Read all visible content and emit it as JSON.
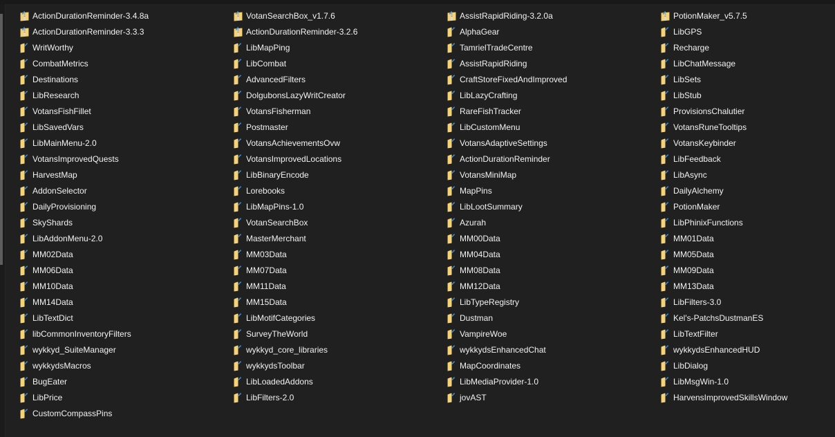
{
  "window": {
    "view_mode": "list",
    "colors": {
      "background": "#202020",
      "text": "#f2f2f2",
      "folder_yellow": "#f4d27a",
      "sync_arrow_blue": "#3a8fd8"
    }
  },
  "scrollbar": {
    "orientation": "vertical",
    "position_fraction": 0.0,
    "visible_fraction": 0.58
  },
  "columns": [
    {
      "items": [
        {
          "name": "ActionDurationReminder-3.4.8a",
          "icon": "zip-folder-icon"
        },
        {
          "name": "ActionDurationReminder-3.3.3",
          "icon": "zip-folder-icon"
        },
        {
          "name": "WritWorthy",
          "icon": "folder-icon"
        },
        {
          "name": "CombatMetrics",
          "icon": "folder-icon"
        },
        {
          "name": "Destinations",
          "icon": "folder-icon"
        },
        {
          "name": "LibResearch",
          "icon": "folder-icon"
        },
        {
          "name": "VotansFishFillet",
          "icon": "folder-icon"
        },
        {
          "name": "LibSavedVars",
          "icon": "folder-icon"
        },
        {
          "name": "LibMainMenu-2.0",
          "icon": "folder-icon"
        },
        {
          "name": "VotansImprovedQuests",
          "icon": "folder-icon"
        },
        {
          "name": "HarvestMap",
          "icon": "folder-icon"
        },
        {
          "name": "AddonSelector",
          "icon": "folder-icon"
        },
        {
          "name": "DailyProvisioning",
          "icon": "folder-icon"
        },
        {
          "name": "SkyShards",
          "icon": "folder-icon"
        },
        {
          "name": "LibAddonMenu-2.0",
          "icon": "folder-icon"
        },
        {
          "name": "MM02Data",
          "icon": "folder-icon"
        },
        {
          "name": "MM06Data",
          "icon": "folder-icon"
        },
        {
          "name": "MM10Data",
          "icon": "folder-icon"
        },
        {
          "name": "MM14Data",
          "icon": "folder-icon"
        },
        {
          "name": "LibTextDict",
          "icon": "folder-icon"
        },
        {
          "name": "libCommonInventoryFilters",
          "icon": "folder-icon"
        },
        {
          "name": "wykkyd_SuiteManager",
          "icon": "folder-icon"
        },
        {
          "name": "wykkydsMacros",
          "icon": "folder-icon"
        },
        {
          "name": "BugEater",
          "icon": "folder-icon"
        },
        {
          "name": "LibPrice",
          "icon": "folder-icon"
        },
        {
          "name": "CustomCompassPins",
          "icon": "folder-icon"
        }
      ]
    },
    {
      "items": [
        {
          "name": "VotanSearchBox_v1.7.6",
          "icon": "zip-folder-icon"
        },
        {
          "name": "ActionDurationReminder-3.2.6",
          "icon": "zip-folder-icon"
        },
        {
          "name": "LibMapPing",
          "icon": "folder-icon"
        },
        {
          "name": "LibCombat",
          "icon": "folder-icon"
        },
        {
          "name": "AdvancedFilters",
          "icon": "folder-icon"
        },
        {
          "name": "DolgubonsLazyWritCreator",
          "icon": "folder-icon"
        },
        {
          "name": "VotansFisherman",
          "icon": "folder-icon"
        },
        {
          "name": "Postmaster",
          "icon": "folder-icon"
        },
        {
          "name": "VotansAchievementsOvw",
          "icon": "folder-icon"
        },
        {
          "name": "VotansImprovedLocations",
          "icon": "folder-icon"
        },
        {
          "name": "LibBinaryEncode",
          "icon": "folder-icon"
        },
        {
          "name": "Lorebooks",
          "icon": "folder-icon"
        },
        {
          "name": "LibMapPins-1.0",
          "icon": "folder-icon"
        },
        {
          "name": "VotanSearchBox",
          "icon": "folder-icon"
        },
        {
          "name": "MasterMerchant",
          "icon": "folder-icon"
        },
        {
          "name": "MM03Data",
          "icon": "folder-icon"
        },
        {
          "name": "MM07Data",
          "icon": "folder-icon"
        },
        {
          "name": "MM11Data",
          "icon": "folder-icon"
        },
        {
          "name": "MM15Data",
          "icon": "folder-icon"
        },
        {
          "name": "LibMotifCategories",
          "icon": "folder-icon"
        },
        {
          "name": "SurveyTheWorld",
          "icon": "folder-icon"
        },
        {
          "name": "wykkyd_core_libraries",
          "icon": "folder-icon"
        },
        {
          "name": "wykkydsToolbar",
          "icon": "folder-icon"
        },
        {
          "name": "LibLoadedAddons",
          "icon": "folder-icon"
        },
        {
          "name": "LibFilters-2.0",
          "icon": "folder-icon"
        }
      ]
    },
    {
      "items": [
        {
          "name": "AssistRapidRiding-3.2.0a",
          "icon": "zip-folder-icon"
        },
        {
          "name": "AlphaGear",
          "icon": "folder-icon"
        },
        {
          "name": "TamrielTradeCentre",
          "icon": "folder-icon"
        },
        {
          "name": "AssistRapidRiding",
          "icon": "folder-icon"
        },
        {
          "name": "CraftStoreFixedAndImproved",
          "icon": "folder-icon"
        },
        {
          "name": "LibLazyCrafting",
          "icon": "folder-icon"
        },
        {
          "name": "RareFishTracker",
          "icon": "folder-icon"
        },
        {
          "name": "LibCustomMenu",
          "icon": "folder-icon"
        },
        {
          "name": "VotansAdaptiveSettings",
          "icon": "folder-icon"
        },
        {
          "name": "ActionDurationReminder",
          "icon": "folder-icon"
        },
        {
          "name": "VotansMiniMap",
          "icon": "folder-icon"
        },
        {
          "name": "MapPins",
          "icon": "folder-icon"
        },
        {
          "name": "LibLootSummary",
          "icon": "folder-icon"
        },
        {
          "name": "Azurah",
          "icon": "folder-icon"
        },
        {
          "name": "MM00Data",
          "icon": "folder-icon"
        },
        {
          "name": "MM04Data",
          "icon": "folder-icon"
        },
        {
          "name": "MM08Data",
          "icon": "folder-icon"
        },
        {
          "name": "MM12Data",
          "icon": "folder-icon"
        },
        {
          "name": "LibTypeRegistry",
          "icon": "folder-icon"
        },
        {
          "name": "Dustman",
          "icon": "folder-icon"
        },
        {
          "name": "VampireWoe",
          "icon": "folder-icon"
        },
        {
          "name": "wykkydsEnhancedChat",
          "icon": "folder-icon"
        },
        {
          "name": "MapCoordinates",
          "icon": "folder-icon"
        },
        {
          "name": "LibMediaProvider-1.0",
          "icon": "folder-icon"
        },
        {
          "name": "jovAST",
          "icon": "folder-icon"
        }
      ]
    },
    {
      "items": [
        {
          "name": "PotionMaker_v5.7.5",
          "icon": "zip-folder-icon"
        },
        {
          "name": "LibGPS",
          "icon": "folder-icon"
        },
        {
          "name": "Recharge",
          "icon": "folder-icon"
        },
        {
          "name": "LibChatMessage",
          "icon": "folder-icon"
        },
        {
          "name": "LibSets",
          "icon": "folder-icon"
        },
        {
          "name": "LibStub",
          "icon": "folder-icon"
        },
        {
          "name": "ProvisionsChalutier",
          "icon": "folder-icon"
        },
        {
          "name": "VotansRuneTooltips",
          "icon": "folder-icon"
        },
        {
          "name": "VotansKeybinder",
          "icon": "folder-icon"
        },
        {
          "name": "LibFeedback",
          "icon": "folder-icon"
        },
        {
          "name": "LibAsync",
          "icon": "folder-icon"
        },
        {
          "name": "DailyAlchemy",
          "icon": "folder-icon"
        },
        {
          "name": "PotionMaker",
          "icon": "folder-icon"
        },
        {
          "name": "LibPhinixFunctions",
          "icon": "folder-icon"
        },
        {
          "name": "MM01Data",
          "icon": "folder-icon"
        },
        {
          "name": "MM05Data",
          "icon": "folder-icon"
        },
        {
          "name": "MM09Data",
          "icon": "folder-icon"
        },
        {
          "name": "MM13Data",
          "icon": "folder-icon"
        },
        {
          "name": "LibFilters-3.0",
          "icon": "folder-icon"
        },
        {
          "name": "Kel's-PatchsDustmanES",
          "icon": "folder-icon"
        },
        {
          "name": "LibTextFilter",
          "icon": "folder-icon"
        },
        {
          "name": "wykkydsEnhancedHUD",
          "icon": "folder-icon"
        },
        {
          "name": "LibDialog",
          "icon": "folder-icon"
        },
        {
          "name": "LibMsgWin-1.0",
          "icon": "folder-icon"
        },
        {
          "name": "HarvensImprovedSkillsWindow",
          "icon": "folder-icon"
        }
      ]
    }
  ]
}
